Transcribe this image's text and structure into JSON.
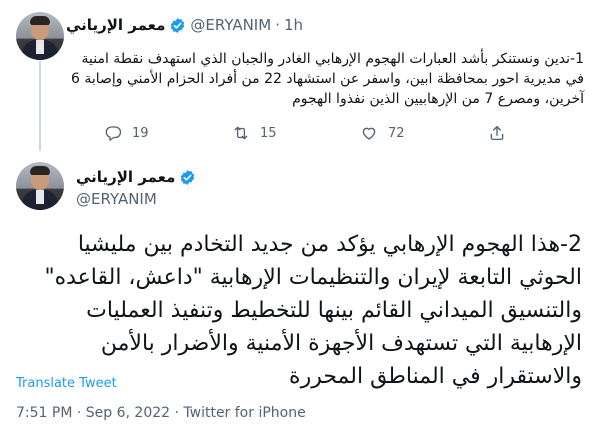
{
  "tweet1": {
    "display_name": "معمر الإرياني",
    "handle": "@ERYANIM",
    "separator": "·",
    "time": "1h",
    "text": "1-ندين ونستنكر بأشد العبارات الهجوم الإرهابي الغادر والجبان الذي استهدف نقطة امنية في مديرية احور بمحافظة ابين، واسفر عن استشهاد 22 من أفراد الحزام الأمني وإصابة 6 آخرين، ومصرع 7 من الإرهابيين الذين نفذوا الهجوم",
    "replies": "19",
    "retweets": "15",
    "likes": "72"
  },
  "tweet2": {
    "display_name": "معمر الإرياني",
    "handle": "@ERYANIM",
    "text": "2-هذا الهجوم الإرهابي يؤكد من جديد التخادم بين مليشيا الحوثي التابعة لإيران والتنظيمات الإرهابية \"داعش، القاعده\" والتنسيق الميداني القائم بينها للتخطيط وتنفيذ العمليات الإرهابية التي تستهدف الأجهزة الأمنية والأضرار بالأمن والاستقرار في المناطق المحررة",
    "translate_label": "Translate Tweet",
    "timestamp": "7:51 PM · Sep 6, 2022 · Twitter for iPhone"
  },
  "colors": {
    "accent": "#1d9bf0",
    "secondary_text": "#536471"
  }
}
